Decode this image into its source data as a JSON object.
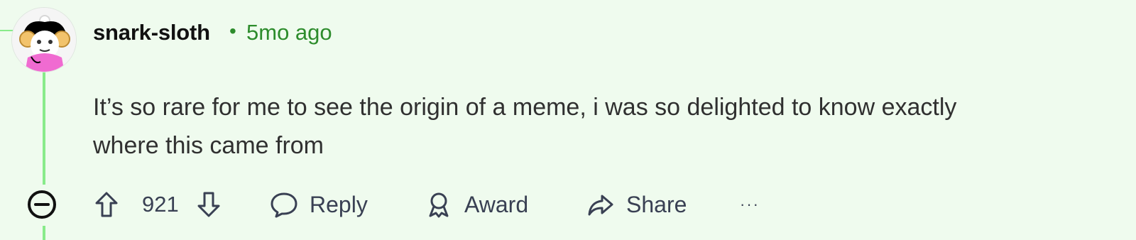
{
  "comment": {
    "username": "snark-sloth",
    "separator": "•",
    "timestamp": "5mo ago",
    "body_lines": [
      "It’s so rare for me to see the origin of a meme, i was so delighted to know exactly",
      "where this came from"
    ],
    "avatar_icon": "user-avatar-icon"
  },
  "actions": {
    "collapse_icon": "minus-circle-icon",
    "upvote_icon": "arrow-up-icon",
    "score": "921",
    "downvote_icon": "arrow-down-icon",
    "reply_label": "Reply",
    "award_label": "Award",
    "share_label": "Share",
    "more_label": "···"
  },
  "colors": {
    "background": "#effbee",
    "thread_line": "#88eb8a",
    "timestamp": "#2d8c2c",
    "text": "#303030",
    "actions": "#394053"
  }
}
